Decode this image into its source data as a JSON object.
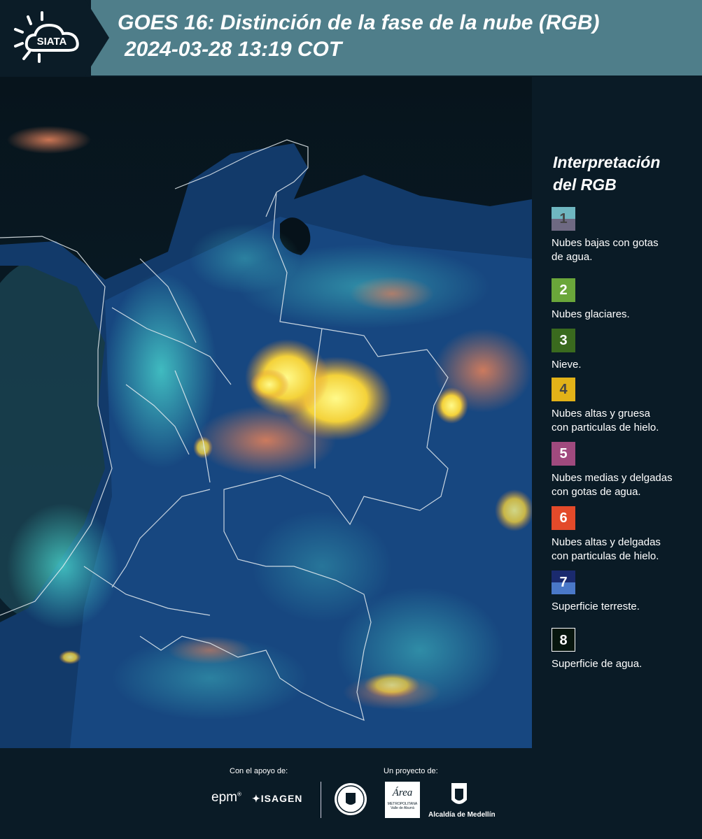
{
  "header": {
    "logo_text": "SIATA",
    "title_line1": "GOES 16: Distinción de la fase de la nube (RGB)",
    "title_line2": "2024-03-28 13:19 COT"
  },
  "legend": {
    "title_line1": "Interpretación",
    "title_line2": "del RGB",
    "items": [
      {
        "num": "1",
        "text_line1": "Nubes bajas con gotas",
        "text_line2": "de agua.",
        "color_top": "#6fb6c0",
        "color_bottom": "#6e6982",
        "num_color": "#444444"
      },
      {
        "num": "2",
        "text_line1": "Nubes glaciares.",
        "text_line2": "",
        "color_top": "#6aa63a",
        "color_bottom": "#6aa63a",
        "num_color": "#ffffff"
      },
      {
        "num": "3",
        "text_line1": "Nieve.",
        "text_line2": "",
        "color_top": "#3a6a1e",
        "color_bottom": "#3a6a1e",
        "num_color": "#ffffff"
      },
      {
        "num": "4",
        "text_line1": "Nubes altas y gruesa",
        "text_line2": "con particulas de hielo.",
        "color_top": "#e2b218",
        "color_bottom": "#e2b218",
        "num_color": "#444444"
      },
      {
        "num": "5",
        "text_line1": "Nubes medias y delgadas",
        "text_line2": "con gotas de agua.",
        "color_top": "#a04a7e",
        "color_bottom": "#a04a7e",
        "num_color": "#ffffff"
      },
      {
        "num": "6",
        "text_line1": "Nubes altas y delgadas",
        "text_line2": "con particulas de hielo.",
        "color_top": "#e34a2a",
        "color_bottom": "#e34a2a",
        "num_color": "#ffffff"
      },
      {
        "num": "7",
        "text_line1": "Superficie terreste.",
        "text_line2": "",
        "color_top": "#1a2a6e",
        "color_bottom": "#4a78c8",
        "num_color": "#ffffff"
      },
      {
        "num": "8",
        "text_line1": "Superficie de agua.",
        "text_line2": "",
        "color_top": "#07160e",
        "color_bottom": "#07160e",
        "num_color": "#ffffff"
      }
    ]
  },
  "footer": {
    "support_label": "Con el apoyo de:",
    "project_label": "Un proyecto de:",
    "epm_text": "epm",
    "isagen_text": "ISAGEN",
    "area_text": "Área",
    "area_sub": "METROPOLITANA",
    "area_sub2": "Valle de Aburrá",
    "alcaldia_text": "Alcaldía de Medellín"
  }
}
